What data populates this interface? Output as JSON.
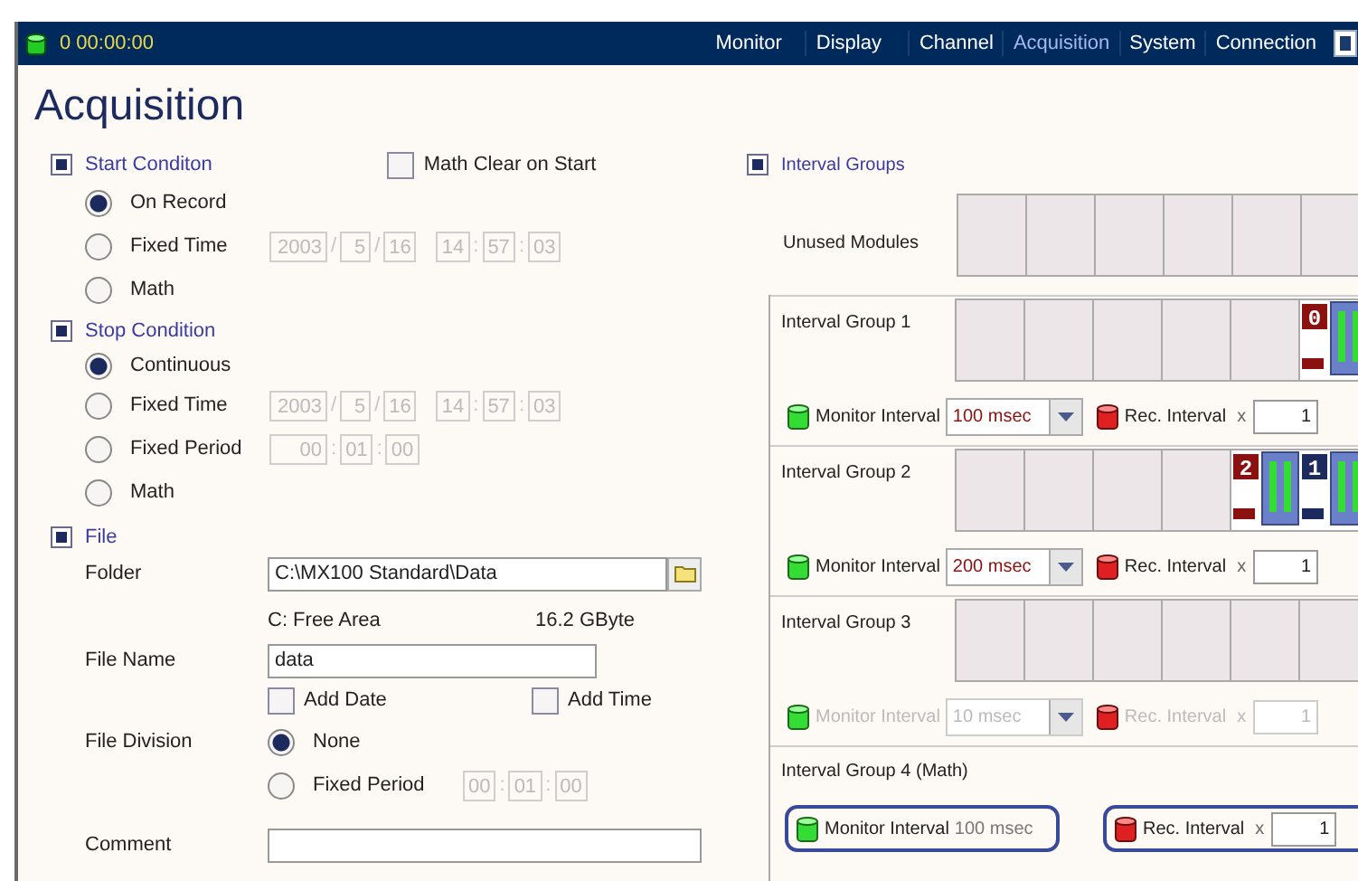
{
  "status": {
    "time": "0 00:00:00"
  },
  "nav": [
    {
      "label": "Monitor",
      "selected": false
    },
    {
      "label": "Display",
      "selected": false
    },
    {
      "label": "Channel",
      "selected": false
    },
    {
      "label": "Acquisition",
      "selected": true
    },
    {
      "label": "System",
      "selected": false
    },
    {
      "label": "Connection",
      "selected": false
    }
  ],
  "title": "Acquisition",
  "start_condition": {
    "label": "Start Conditon",
    "checked": true,
    "math_clear": {
      "label": "Math Clear on Start",
      "checked": false
    },
    "options": [
      {
        "label": "On Record",
        "selected": true,
        "kind": "plain"
      },
      {
        "label": "Fixed Time",
        "selected": false,
        "kind": "datetime",
        "disabled": true,
        "date": {
          "sep": "/",
          "parts": [
            "2003",
            "5",
            "16"
          ]
        },
        "time": {
          "sep": ":",
          "parts": [
            "14",
            "57",
            "03"
          ]
        }
      },
      {
        "label": "Math",
        "selected": false,
        "kind": "plain"
      }
    ]
  },
  "stop_condition": {
    "label": "Stop Condition",
    "checked": true,
    "options": [
      {
        "label": "Continuous",
        "selected": true,
        "kind": "plain"
      },
      {
        "label": "Fixed Time",
        "selected": false,
        "kind": "datetime",
        "disabled": true,
        "date": {
          "sep": "/",
          "parts": [
            "2003",
            "5",
            "16"
          ]
        },
        "time": {
          "sep": ":",
          "parts": [
            "14",
            "57",
            "03"
          ]
        }
      },
      {
        "label": "Fixed Period",
        "selected": false,
        "kind": "period",
        "disabled": true,
        "time": {
          "sep": ":",
          "parts": [
            "00",
            "01",
            "00"
          ]
        }
      },
      {
        "label": "Math",
        "selected": false,
        "kind": "plain"
      }
    ]
  },
  "file": {
    "label": "File",
    "checked": true,
    "folder": {
      "label": "Folder",
      "value": "C:\\MX100 Standard\\Data"
    },
    "free_area": {
      "label": "C: Free Area",
      "value": "16.2 GByte"
    },
    "file_name": {
      "label": "File Name",
      "value": "data"
    },
    "add_date": {
      "label": "Add Date",
      "checked": false
    },
    "add_time": {
      "label": "Add Time",
      "checked": false
    },
    "division": {
      "label": "File Division",
      "options": [
        {
          "label": "None",
          "selected": true,
          "kind": "plain"
        },
        {
          "label": "Fixed Period",
          "selected": false,
          "kind": "period",
          "disabled": true,
          "time": {
            "sep": ":",
            "parts": [
              "00",
              "01",
              "00"
            ]
          }
        }
      ]
    },
    "comment": {
      "label": "Comment"
    }
  },
  "interval_groups": {
    "label": "Interval Groups",
    "checked": true,
    "unused": {
      "label": "Unused Modules"
    },
    "groups": [
      {
        "label": "Interval Group 1",
        "kind": "normal",
        "disabled": false,
        "modules": [
          {
            "number": "0",
            "color": "#8b1010"
          }
        ],
        "monitor": {
          "label": "Monitor Interval",
          "value": "100 msec"
        },
        "rec": {
          "label": "Rec. Interval",
          "sign": "x",
          "value": "1"
        }
      },
      {
        "label": "Interval Group 2",
        "kind": "normal",
        "disabled": false,
        "modules": [
          {
            "number": "2",
            "color": "#8b1010"
          },
          {
            "number": "1",
            "color": "#1c2a5e"
          }
        ],
        "monitor": {
          "label": "Monitor Interval",
          "value": "200 msec"
        },
        "rec": {
          "label": "Rec. Interval",
          "sign": "x",
          "value": "1"
        }
      },
      {
        "label": "Interval Group 3",
        "kind": "normal",
        "disabled": true,
        "monitor": {
          "label": "Monitor Interval",
          "value": "10 msec"
        },
        "rec": {
          "label": "Rec. Interval",
          "sign": "x",
          "value": "1"
        }
      },
      {
        "label": "Interval Group 4 (Math)",
        "kind": "math",
        "disabled": false,
        "monitor": {
          "label": "Monitor Interval",
          "value": "100 msec"
        },
        "rec": {
          "label": "Rec. Interval",
          "sign": "x",
          "value": "1"
        }
      }
    ]
  }
}
